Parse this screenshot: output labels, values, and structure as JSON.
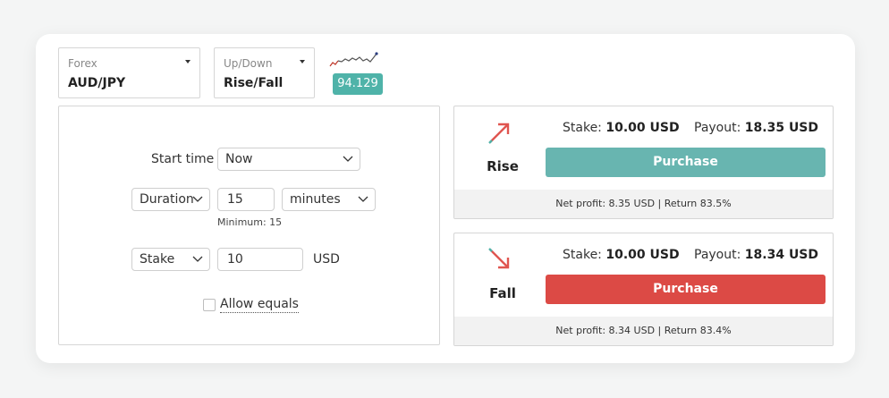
{
  "market": {
    "label": "Forex",
    "value": "AUD/JPY"
  },
  "trade_type": {
    "label": "Up/Down",
    "value": "Rise/Fall"
  },
  "spot_price": "94.129",
  "form": {
    "start_time_label": "Start time",
    "start_time_value": "Now",
    "duration_type": "Duration",
    "duration_value": "15",
    "duration_unit": "minutes",
    "duration_min_note": "Minimum: 15",
    "amount_type": "Stake",
    "amount_value": "10",
    "currency": "USD",
    "allow_equals_label": "Allow equals"
  },
  "contracts": [
    {
      "name": "Rise",
      "stake_label": "Stake:",
      "stake_value": "10.00 USD",
      "payout_label": "Payout:",
      "payout_value": "18.35 USD",
      "button_label": "Purchase",
      "button_color": "#68b5b0",
      "footer": "Net profit: 8.35 USD | Return 83.5%"
    },
    {
      "name": "Fall",
      "stake_label": "Stake:",
      "stake_value": "10.00 USD",
      "payout_label": "Payout:",
      "payout_value": "18.34 USD",
      "button_label": "Purchase",
      "button_color": "#dc4a45",
      "footer": "Net profit: 8.34 USD | Return 83.4%"
    }
  ],
  "icons": {
    "rise": "arrow-up-right-icon",
    "fall": "arrow-down-right-icon",
    "sparkline": "price-sparkline-icon",
    "dropdown": "caret-down-icon",
    "select": "chevron-down-icon"
  }
}
